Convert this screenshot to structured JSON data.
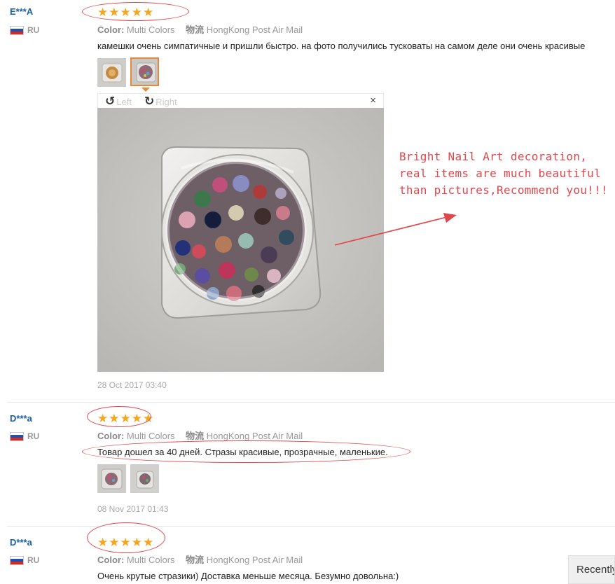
{
  "reviews": [
    {
      "user": "E***A",
      "country": "RU",
      "stars": 5,
      "color_label": "Color:",
      "color_value": "Multi Colors",
      "ship_label": "物流",
      "ship_value": "HongKong Post Air Mail",
      "text": "камешки очень симпатичные и пришли быстро. на фото получились тусковаты на самом деле они очень красивые",
      "date": "28 Oct 2017 03:40"
    },
    {
      "user": "D***a",
      "country": "RU",
      "stars": 5,
      "color_label": "Color:",
      "color_value": "Multi Colors",
      "ship_label": "物流",
      "ship_value": "HongKong Post Air Mail",
      "text": "Товар дошел за 40 дней. Стразы красивые, прозрачные, маленькие.",
      "date": "08 Nov 2017 01:43"
    },
    {
      "user": "D***a",
      "country": "RU",
      "stars": 5,
      "color_label": "Color:",
      "color_value": "Multi Colors",
      "ship_label": "物流",
      "ship_value": "HongKong Post Air Mail",
      "text": "Очень крутые стразики) Доставка меньше месяца. Безумно довольна:)"
    }
  ],
  "viewer": {
    "rotate_left": "Left",
    "rotate_right": "Right",
    "close": "×"
  },
  "annotation": {
    "text": "Bright Nail Art decoration, real items are much beautiful than pictures,Recommend you!!!",
    "color": "#e0474c"
  },
  "recently_tab": "Recently",
  "colors": {
    "username": "#1a5fa6",
    "star": "#f7a51c",
    "highlight": "#e0474c"
  }
}
